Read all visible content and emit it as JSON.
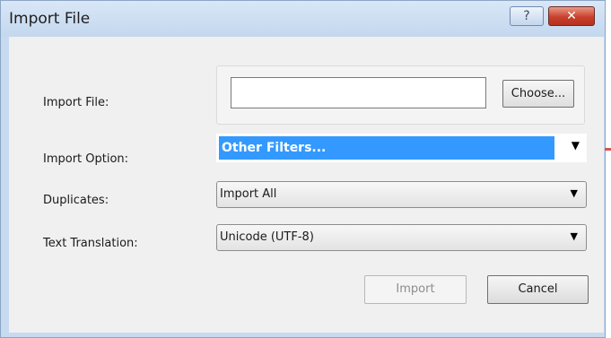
{
  "window": {
    "title": "Import File",
    "help_label": "?",
    "close_label": "✕"
  },
  "form": {
    "import_file": {
      "label": "Import File:",
      "value": "",
      "choose_label": "Choose..."
    },
    "import_option": {
      "label": "Import Option:",
      "selected": "Other Filters..."
    },
    "duplicates": {
      "label": "Duplicates:",
      "selected": "Import All"
    },
    "text_translation": {
      "label": "Text Translation:",
      "selected": "Unicode (UTF-8)"
    }
  },
  "buttons": {
    "import_label": "Import",
    "cancel_label": "Cancel"
  },
  "colors": {
    "selection_highlight": "#3399ff",
    "close_button": "#c8412d",
    "dialog_border": "#c7daf0"
  }
}
